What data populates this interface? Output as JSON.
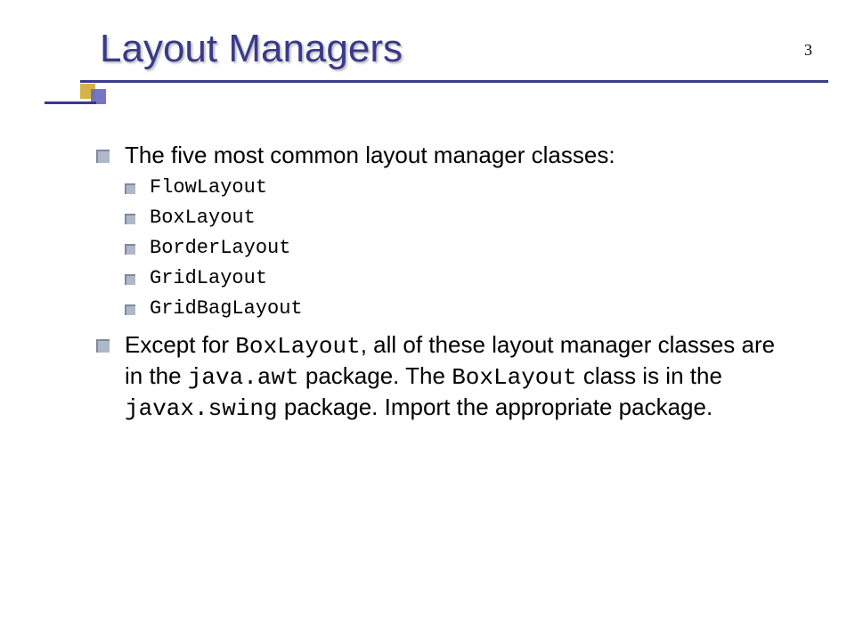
{
  "page_number": "3",
  "title": "Layout Managers",
  "bullets": {
    "intro_text": "The five most common layout manager classes:",
    "layouts": [
      "FlowLayout",
      "BoxLayout",
      "BorderLayout",
      "GridLayout",
      "GridBagLayout"
    ],
    "para": {
      "p1": "Except for ",
      "c1": "BoxLayout",
      "p2": ", all of these layout manager classes are in the ",
      "c2": "java.awt",
      "p3": " package. The ",
      "c3": "BoxLayout",
      "p4": " class is in the ",
      "c4": "javax.swing",
      "p5": " package. Import the appropriate package."
    }
  }
}
